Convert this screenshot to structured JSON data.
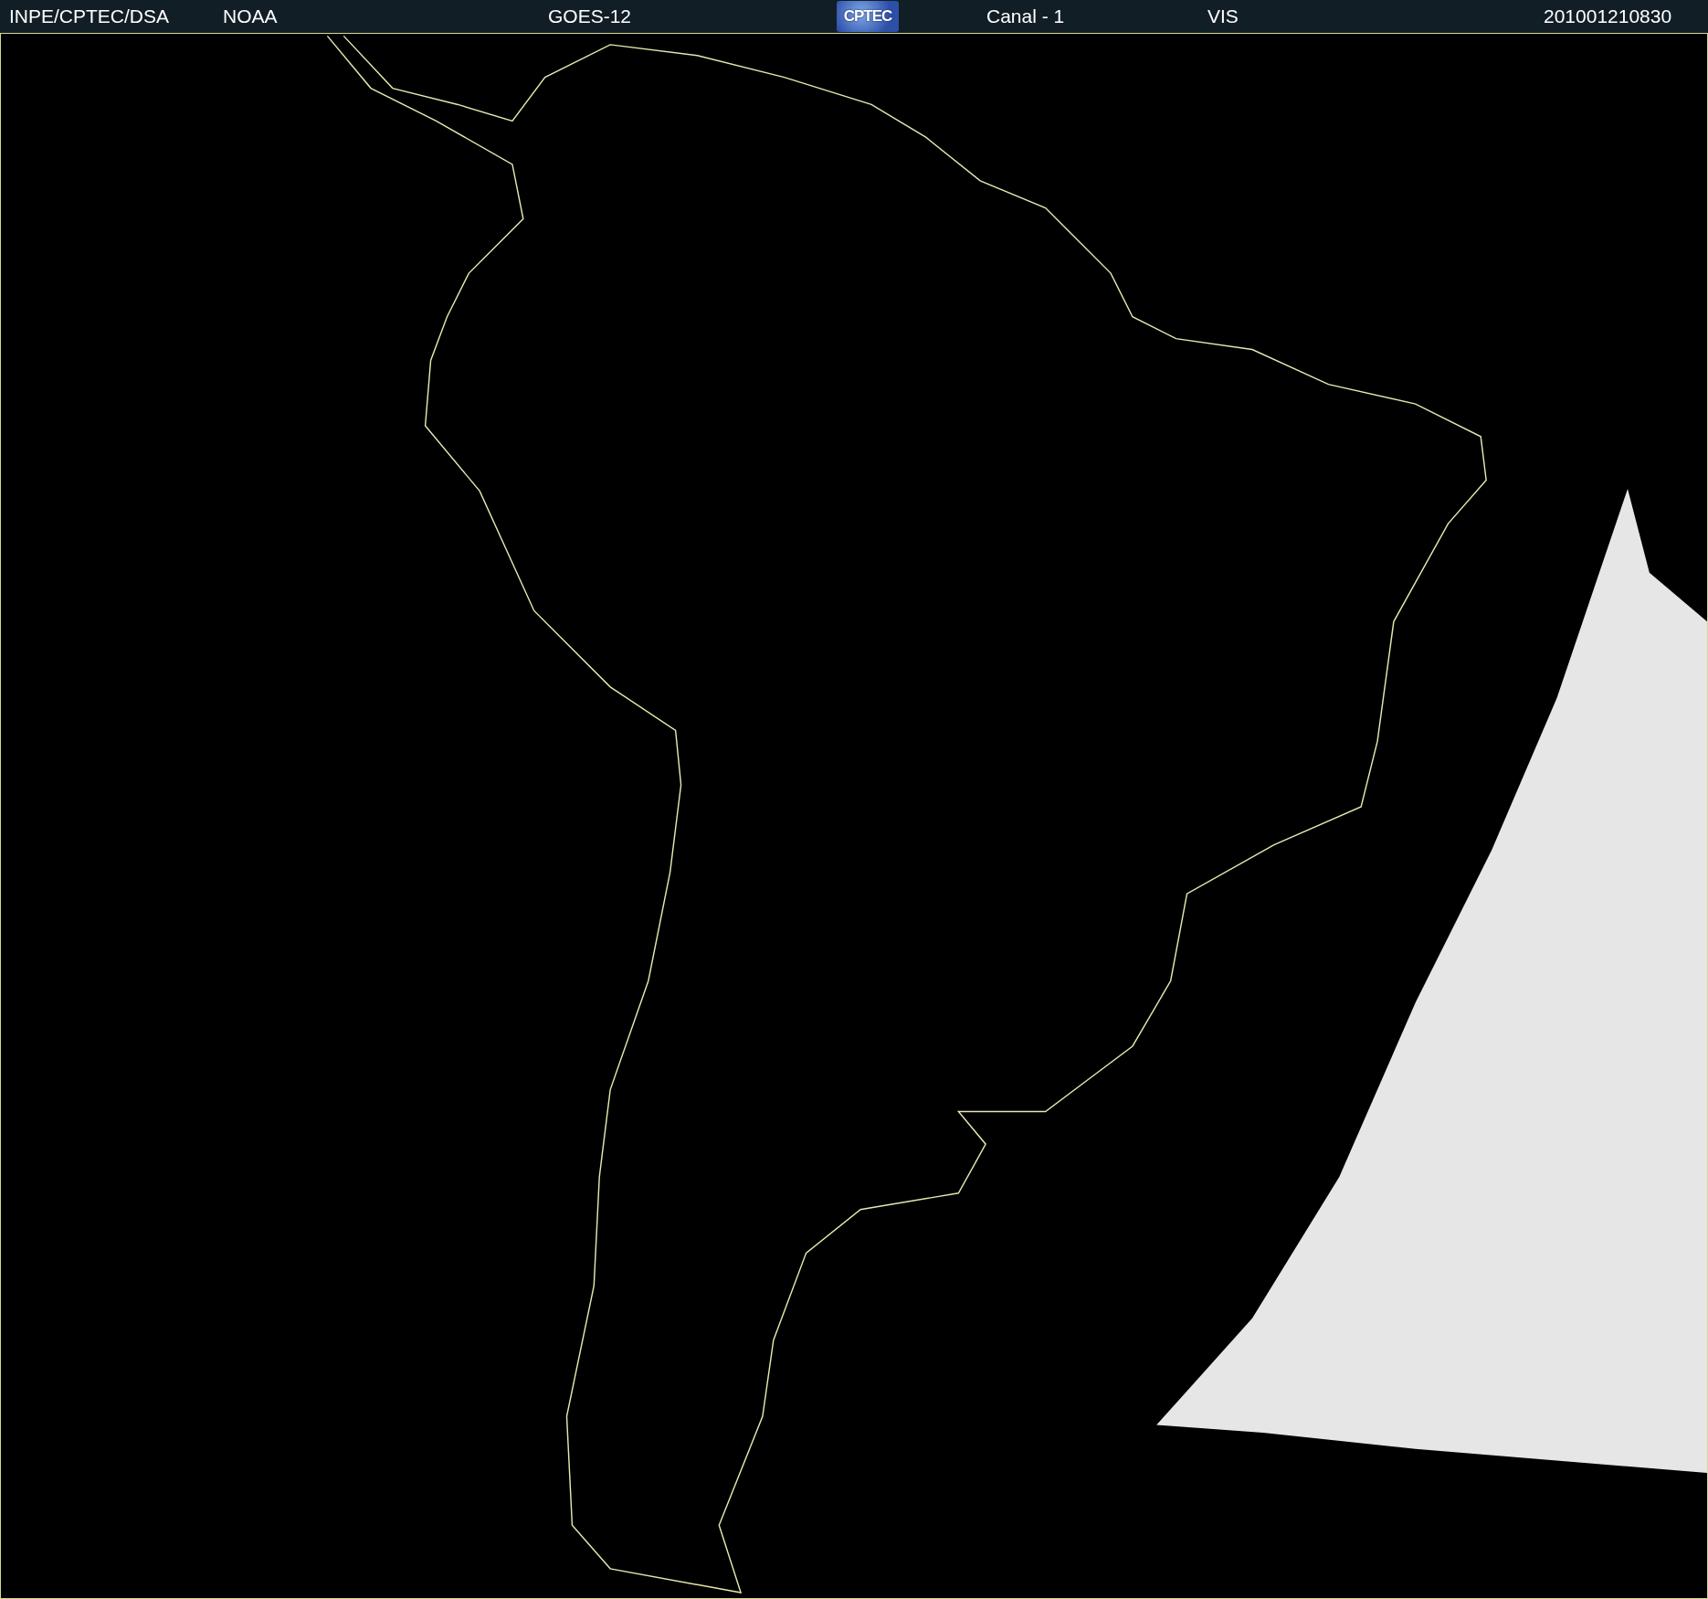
{
  "header": {
    "items": [
      {
        "kind": "text",
        "text": "INPE/CPTEC/DSA"
      },
      {
        "kind": "text",
        "text": "NOAA"
      },
      {
        "kind": "text",
        "text": "GOES-12"
      },
      {
        "kind": "logo",
        "text": "CPTEC"
      },
      {
        "kind": "text",
        "text": "Canal - 1"
      },
      {
        "kind": "text",
        "text": "VIS"
      },
      {
        "kind": "text",
        "text": "201001210830"
      }
    ]
  }
}
